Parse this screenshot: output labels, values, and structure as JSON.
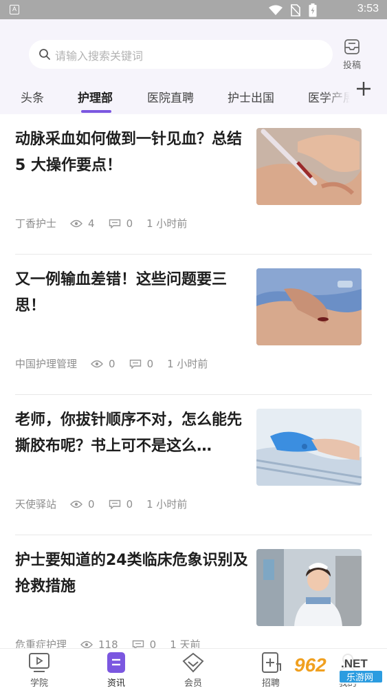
{
  "status_bar": {
    "time": "3:53",
    "app_icon_letter": "A"
  },
  "search": {
    "placeholder": "请输入搜索关键词"
  },
  "contribute": {
    "label": "投稿"
  },
  "tabs": [
    {
      "label": "头条"
    },
    {
      "label": "护理部"
    },
    {
      "label": "医院直聘"
    },
    {
      "label": "护士出国"
    },
    {
      "label": "医学产展"
    }
  ],
  "active_tab": "护理部",
  "accent_color": "#7b57e0",
  "articles": [
    {
      "title": "动脉采血如何做到一针见血？总结 5 大操作要点！",
      "source": "丁香护士",
      "views": "4",
      "comments": "0",
      "time": "1 小时前"
    },
    {
      "title": "又一例输血差错！这些问题要三思！",
      "source": "中国护理管理",
      "views": "0",
      "comments": "0",
      "time": "1 小时前"
    },
    {
      "title": "老师，你拔针顺序不对，怎么能先撕胶布呢？书上可不是这么…",
      "source": "天使驿站",
      "views": "0",
      "comments": "0",
      "time": "1 小时前"
    },
    {
      "title": "护士要知道的24类临床危象识别及抢救措施",
      "source": "危重症护理",
      "views": "118",
      "comments": "0",
      "time": "1 天前"
    }
  ],
  "bottom_nav": [
    {
      "label": "学院",
      "icon": "play-screen-icon"
    },
    {
      "label": "资讯",
      "icon": "news-icon"
    },
    {
      "label": "会员",
      "icon": "diamond-icon"
    },
    {
      "label": "招聘",
      "icon": "job-icon"
    },
    {
      "label": "我的",
      "icon": "profile-icon"
    }
  ],
  "active_nav": "资讯",
  "watermark": {
    "text_main": "962",
    "text_net": ".NET",
    "text_sub": "乐游网"
  }
}
